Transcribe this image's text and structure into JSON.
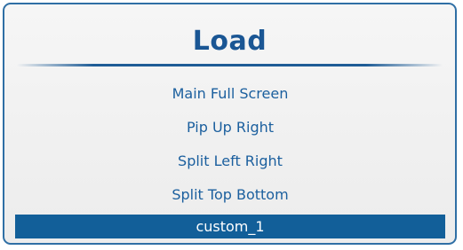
{
  "dialog": {
    "title": "Load",
    "items": [
      {
        "label": "Main Full Screen",
        "selected": false
      },
      {
        "label": "Pip Up Right",
        "selected": false
      },
      {
        "label": "Split Left Right",
        "selected": false
      },
      {
        "label": "Split Top Bottom",
        "selected": false
      },
      {
        "label": "custom_1",
        "selected": true
      }
    ]
  },
  "colors": {
    "accent": "#1a5694",
    "selection": "#125f99",
    "border": "#2f6fa5"
  }
}
